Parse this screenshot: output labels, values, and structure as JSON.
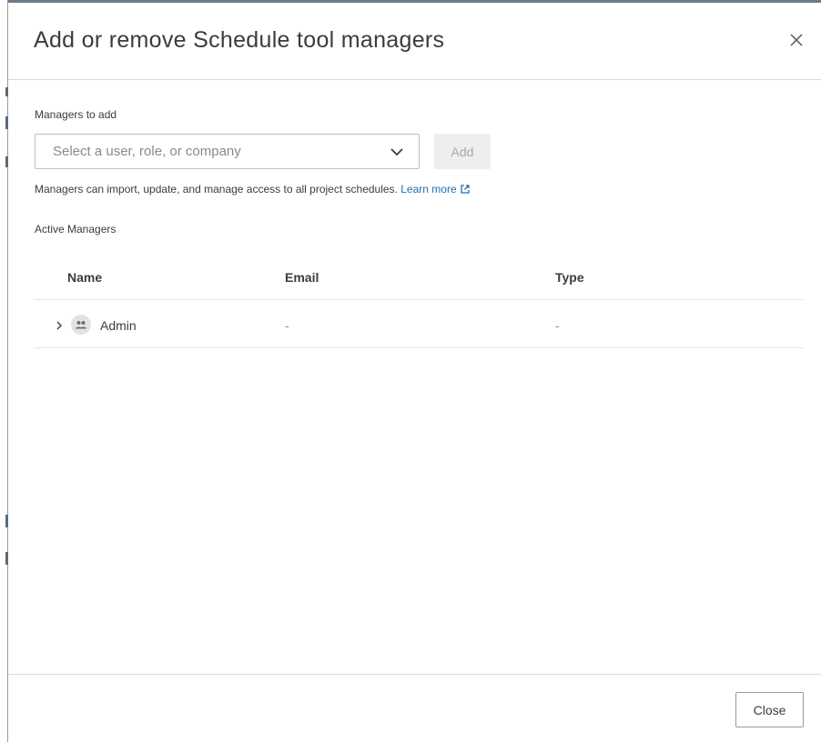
{
  "dialog": {
    "title": "Add or remove Schedule tool managers",
    "close_icon": "close-icon"
  },
  "add_section": {
    "label": "Managers to add",
    "select": {
      "placeholder": "Select a user, role, or company",
      "icon": "chevron-down-icon"
    },
    "add_button": "Add",
    "help_text": "Managers can import, update, and manage access to all project schedules.",
    "learn_more": "Learn more",
    "learn_more_icon": "external-link-icon"
  },
  "active_section": {
    "label": "Active Managers",
    "columns": {
      "name": "Name",
      "email": "Email",
      "type": "Type"
    },
    "rows": [
      {
        "name": "Admin",
        "email": "-",
        "type": "-",
        "icon": "role-group-icon",
        "expand_icon": "chevron-right-icon"
      }
    ]
  },
  "footer": {
    "close_button": "Close"
  },
  "colors": {
    "link": "#1f6fb2",
    "text": "#3c3c3c",
    "muted": "#8a8a8a",
    "disabled_bg": "#eeeeee",
    "divider": "#dcdcdc"
  }
}
